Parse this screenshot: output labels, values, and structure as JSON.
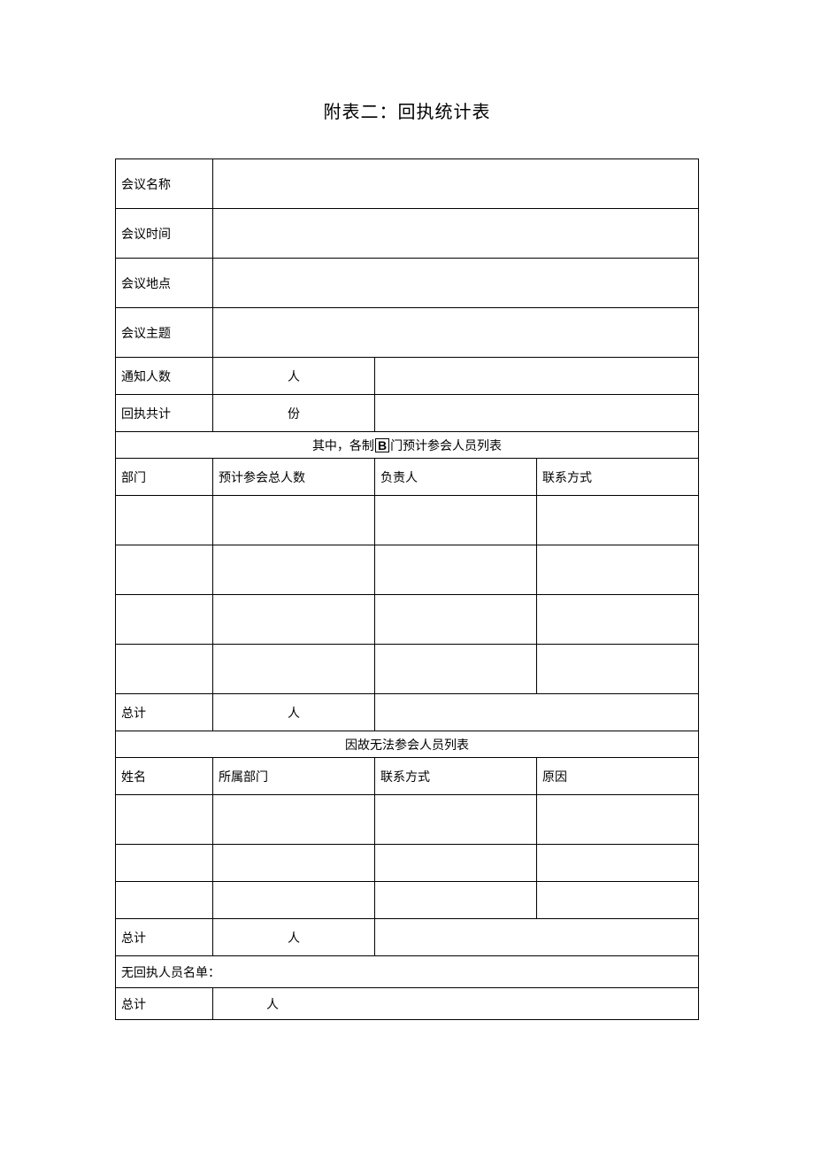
{
  "title": "附表二：回执统计表",
  "labels": {
    "meeting_name": "会议名称",
    "meeting_time": "会议时间",
    "meeting_place": "会议地点",
    "meeting_topic": "会议主题",
    "notified_count": "通知人数",
    "receipt_total": "回执共计"
  },
  "values": {
    "meeting_name": "",
    "meeting_time": "",
    "meeting_place": "",
    "meeting_topic": "",
    "notified_count": "",
    "receipt_total": ""
  },
  "units": {
    "person": "人",
    "copies": "份"
  },
  "section1": {
    "header_prefix": "其中，各制",
    "header_boxed": "B",
    "header_suffix": "门预计参会人员列表",
    "col_dept": "部门",
    "col_expected": "预计参会总人数",
    "col_leader": "负责人",
    "col_contact": "联系方式",
    "rows": [
      {
        "dept": "",
        "expected": "",
        "leader": "",
        "contact": ""
      },
      {
        "dept": "",
        "expected": "",
        "leader": "",
        "contact": ""
      },
      {
        "dept": "",
        "expected": "",
        "leader": "",
        "contact": ""
      },
      {
        "dept": "",
        "expected": "",
        "leader": "",
        "contact": ""
      }
    ],
    "total_label": "总计",
    "total_value": ""
  },
  "section2": {
    "header": "因故无法参会人员列表",
    "col_name": "姓名",
    "col_dept": "所属部门",
    "col_contact": "联系方式",
    "col_reason": "原因",
    "rows": [
      {
        "name": "",
        "dept": "",
        "contact": "",
        "reason": ""
      },
      {
        "name": "",
        "dept": "",
        "contact": "",
        "reason": ""
      },
      {
        "name": "",
        "dept": "",
        "contact": "",
        "reason": ""
      }
    ],
    "total_label": "总计",
    "total_value": ""
  },
  "section3": {
    "no_receipt_label": "无回执人员名单：",
    "no_receipt_value": "",
    "total_label": "总计",
    "total_value": ""
  }
}
